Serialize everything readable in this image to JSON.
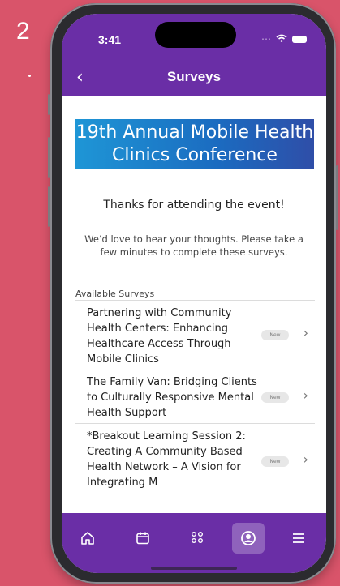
{
  "slide": {
    "number": "2"
  },
  "status_bar": {
    "time": "3:41"
  },
  "nav": {
    "title": "Surveys"
  },
  "banner": {
    "line1": "19th Annual Mobile Health",
    "line2": "Clinics Conference"
  },
  "thanks": "Thanks for attending the event!",
  "note": "We’d love to hear your thoughts. Please take a few minutes to complete these surveys.",
  "section_label": "Available Surveys",
  "surveys": [
    {
      "title": "Partnering with Community Health Centers: Enhancing Healthcare Access Through Mobile Clinics",
      "badge": "New"
    },
    {
      "title": "The Family Van: Bridging Clients to Culturally Responsive Mental Health Support",
      "badge": "New"
    },
    {
      "title": "*Breakout Learning Session 2: Creating A Community Based Health Network – A Vision for Integrating M",
      "badge": "New"
    }
  ],
  "tabs": [
    {
      "icon": "home-icon"
    },
    {
      "icon": "calendar-icon"
    },
    {
      "icon": "people-icon"
    },
    {
      "icon": "profile-icon",
      "active": true
    },
    {
      "icon": "menu-icon"
    }
  ],
  "colors": {
    "accent": "#6a2ea6",
    "background": "#d9546a"
  }
}
